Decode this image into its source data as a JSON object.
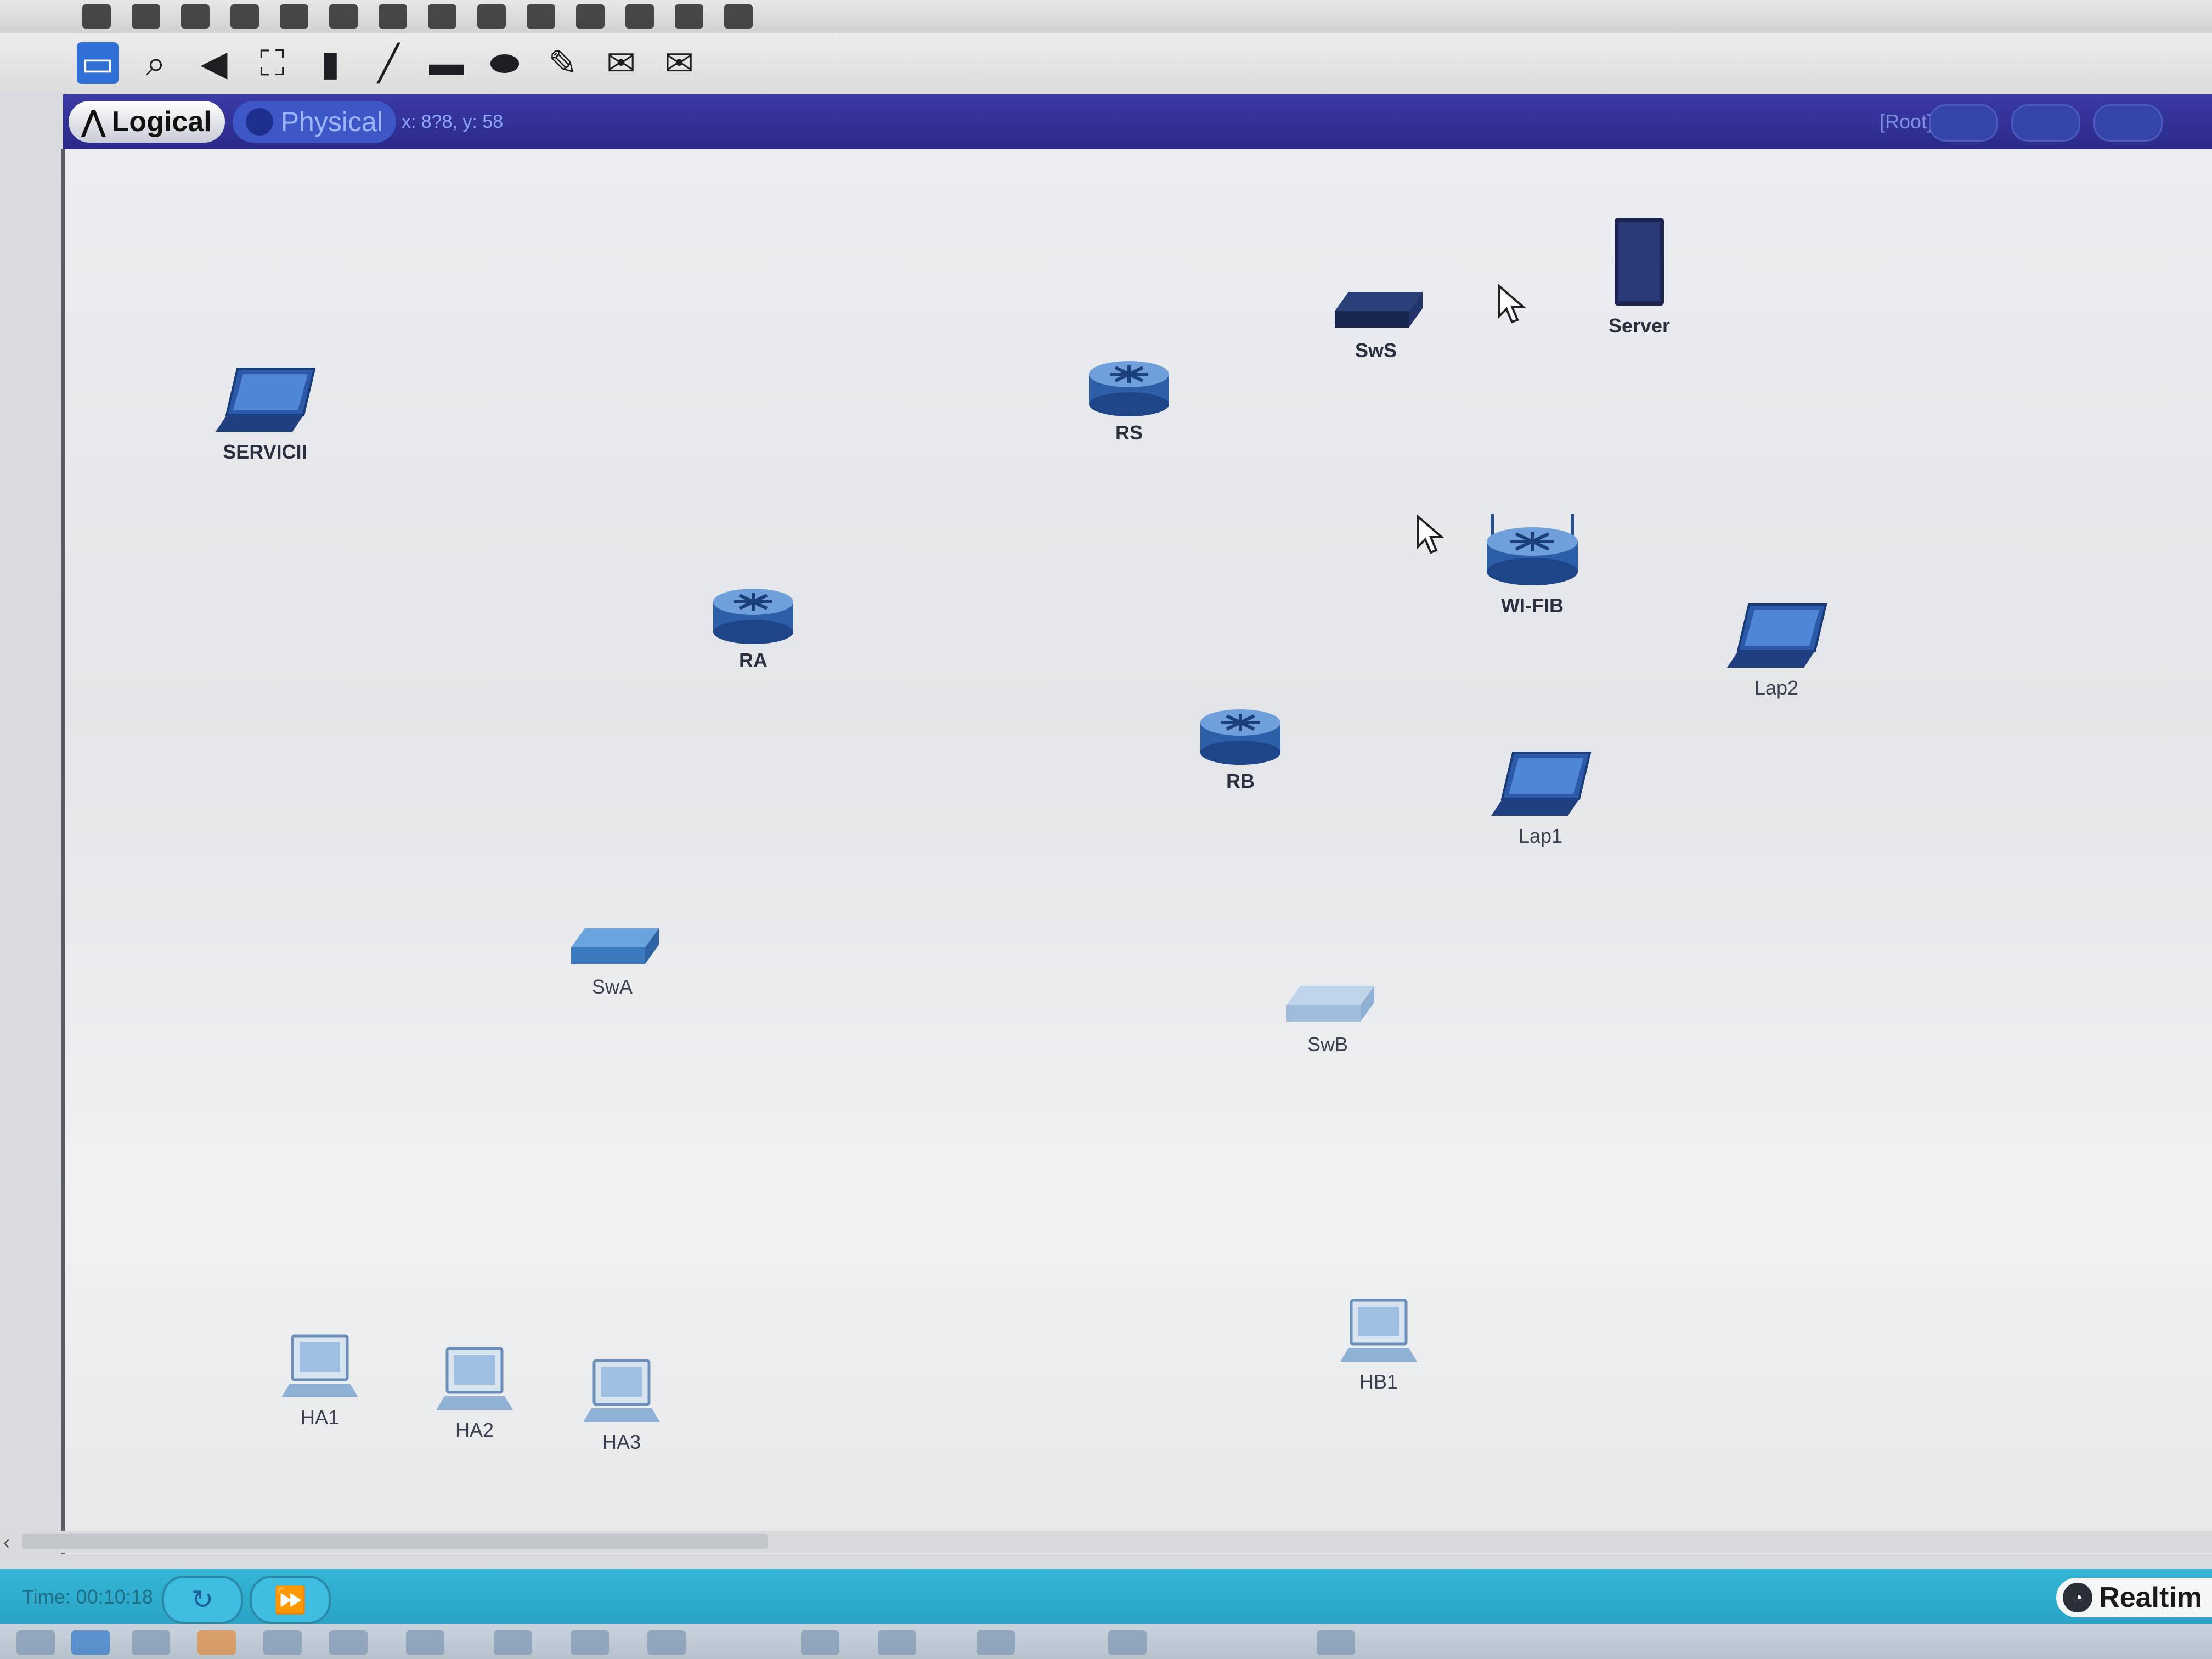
{
  "view_tabs": {
    "logical": "Logical",
    "physical": "Physical"
  },
  "coords_text": "x: 8?8, y: 58",
  "root_label": "[Root]",
  "devices": {
    "servici": "SERVICII",
    "rs": "RS",
    "sws": "SwS",
    "server": "Server",
    "wifi_b": "WI-FIB",
    "ra": "RA",
    "rb": "RB",
    "lap2": "Lap2",
    "lap1": "Lap1",
    "swa": "SwA",
    "swb": "SwB",
    "ha1": "HA1",
    "ha2": "HA2",
    "ha3": "HA3",
    "hb1": "HB1"
  },
  "status": {
    "time": "Time: 00:10:18",
    "realtime": "Realtim"
  },
  "colors": {
    "viewbar": "#2a2a8a",
    "status": "#2aa3c5",
    "device_dark": "#1f3a7a",
    "device_light": "#6fa6d8"
  }
}
